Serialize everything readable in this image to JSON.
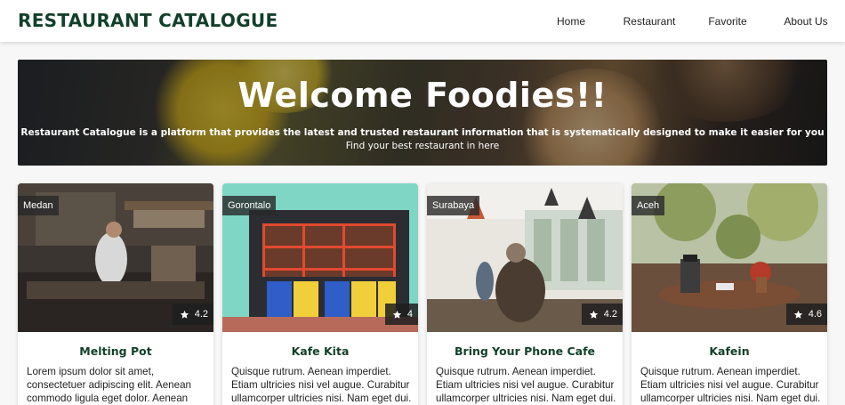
{
  "brand": "RESTAURANT CATALOGUE",
  "nav": [
    "Home",
    "Restaurant",
    "Favorite",
    "About Us"
  ],
  "hero": {
    "title": "Welcome Foodies!!",
    "description": "Restaurant Catalogue is a platform that provides the latest and trusted restaurant information that is systematically designed to make it easier for you",
    "subtitle": "Find your best restaurant in here"
  },
  "restaurants": [
    {
      "name": "Melting Pot",
      "city": "Medan",
      "rating": "4.2",
      "description": "Lorem ipsum dolor sit amet, consectetuer adipiscing elit. Aenean commodo ligula eget dolor. Aenean"
    },
    {
      "name": "Kafe Kita",
      "city": "Gorontalo",
      "rating": "4",
      "description": "Quisque rutrum. Aenean imperdiet. Etiam ultricies nisi vel augue. Curabitur ullamcorper ultricies nisi. Nam eget dui."
    },
    {
      "name": "Bring Your Phone Cafe",
      "city": "Surabaya",
      "rating": "4.2",
      "description": "Quisque rutrum. Aenean imperdiet. Etiam ultricies nisi vel augue. Curabitur ullamcorper ultricies nisi. Nam eget dui."
    },
    {
      "name": "Kafein",
      "city": "Aceh",
      "rating": "4.6",
      "description": "Quisque rutrum. Aenean imperdiet. Etiam ultricies nisi vel augue. Curabitur ullamcorper ultricies nisi. Nam eget dui."
    }
  ],
  "icons": {
    "rating": "star-icon"
  },
  "colors": {
    "brand": "#133f2b",
    "navbar": "#ffffff",
    "background": "#f7f7f7"
  }
}
